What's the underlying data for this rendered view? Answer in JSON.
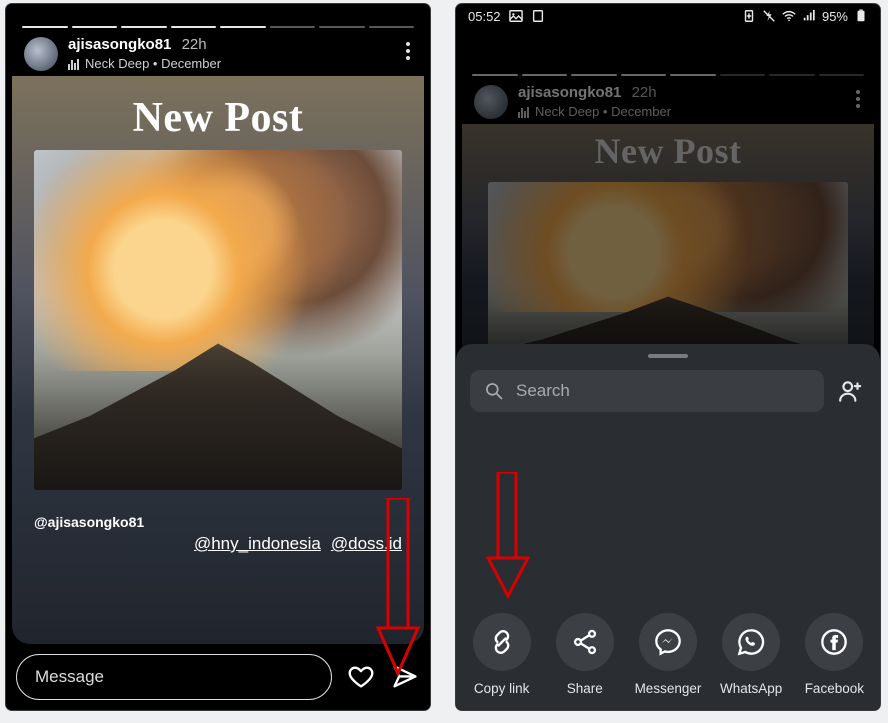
{
  "status": {
    "time": "05:52",
    "battery_pct": "95%"
  },
  "story": {
    "username": "ajisasongko81",
    "time_ago": "22h",
    "music_track": "Neck Deep • December",
    "post_title": "New Post",
    "caption_tag": "@ajisasongko81",
    "mention1": "@hny_indonesia",
    "mention2": "@doss.id"
  },
  "story_footer": {
    "message_placeholder": "Message"
  },
  "share_sheet": {
    "search_placeholder": "Search",
    "items": [
      {
        "label": "Copy link"
      },
      {
        "label": "Share"
      },
      {
        "label": "Messenger"
      },
      {
        "label": "WhatsApp"
      },
      {
        "label": "Facebook"
      }
    ]
  }
}
